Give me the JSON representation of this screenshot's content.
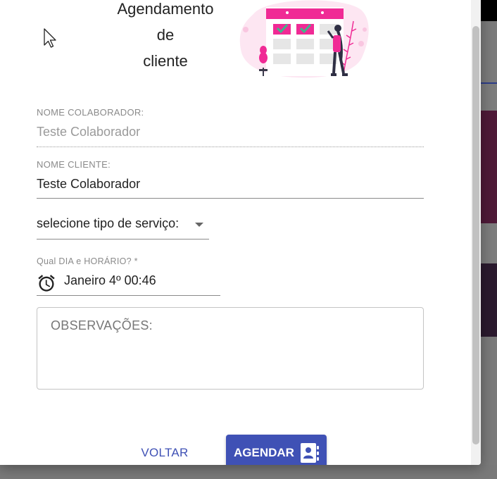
{
  "dialog": {
    "title_lines": [
      "Agendamento",
      "de",
      "cliente"
    ]
  },
  "form": {
    "colaborador": {
      "label": "NOME COLABORADOR:",
      "value": "Teste Colaborador"
    },
    "cliente": {
      "label": "NOME CLIENTE:",
      "value": "Teste Colaborador"
    },
    "servico": {
      "selected": "selecione tipo de serviço:"
    },
    "dia_horario": {
      "label": "Qual DIA e HORÁRIO? *",
      "value": "Janeiro 4º 00:46"
    },
    "observacoes": {
      "placeholder": "OBSERVAÇÕES:"
    }
  },
  "actions": {
    "voltar": "VOLTAR",
    "agendar": "AGENDAR"
  },
  "icons": {
    "time": "alarm-clock-icon",
    "submit": "contact-card-icon",
    "select": "dropdown-arrow-icon"
  },
  "colors": {
    "primary": "#3f51b5",
    "illustration_accent": "#f02a95"
  }
}
